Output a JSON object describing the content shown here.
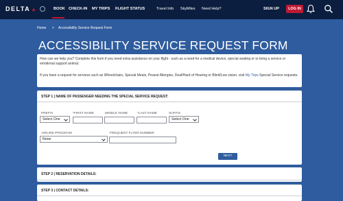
{
  "header": {
    "logo": "DELTA",
    "nav_main": [
      "BOOK",
      "CHECK-IN",
      "MY TRIPS",
      "FLIGHT STATUS"
    ],
    "nav_secondary": [
      "Travel Info",
      "SkyMiles",
      "Need Help?"
    ],
    "sign_up": "SIGN UP",
    "log_in": "LOG IN",
    "accent_color": "#c01933",
    "bg_color": "#0b1e3f"
  },
  "breadcrumb": {
    "home": "Home",
    "separator": ">",
    "current": "Accessibility Service Request Form"
  },
  "page": {
    "title": "ACCESSIBILITY SERVICE REQUEST FORM",
    "intro_1": "How can we help you? Complete this form if you need extra assistance on your flight - such as a need for a medical device, special seating or to bring a service or emotional support animal.",
    "intro_2_pre": "If you have a request for services such as Wheelchairs, Special Meals, Peanut Allergies, Deaf/Hard of Hearing or Blind/Low vision, visit ",
    "intro_2_link": "My Trips",
    "intro_2_post": " Special Service requests.",
    "bg_color": "#2f5c9e"
  },
  "step1": {
    "heading": "STEP 1 | NAME OF PASSENGER NEEDING THE SPECIAL SERVICE REQUEST:",
    "prefix_label": "PREFIX",
    "prefix_value": "Select One",
    "first_label": "*FIRST NAME",
    "first_value": "",
    "middle_label": "MIDDLE NAME",
    "middle_value": "",
    "last_label": "*LAST NAME",
    "last_value": "",
    "suffix_label": "SUFFIX",
    "suffix_value": "Select One",
    "airline_label": "AIRLINE PROGRAM",
    "airline_value": "None",
    "ffn_label": "FREQUENT FLYER NUMBER",
    "ffn_value": "",
    "next": "NEXT"
  },
  "step2": {
    "heading": "STEP 2 | RESERVATION DETAILS:"
  },
  "step3": {
    "heading": "STEP 3 | CONTACT DETAILS:"
  }
}
